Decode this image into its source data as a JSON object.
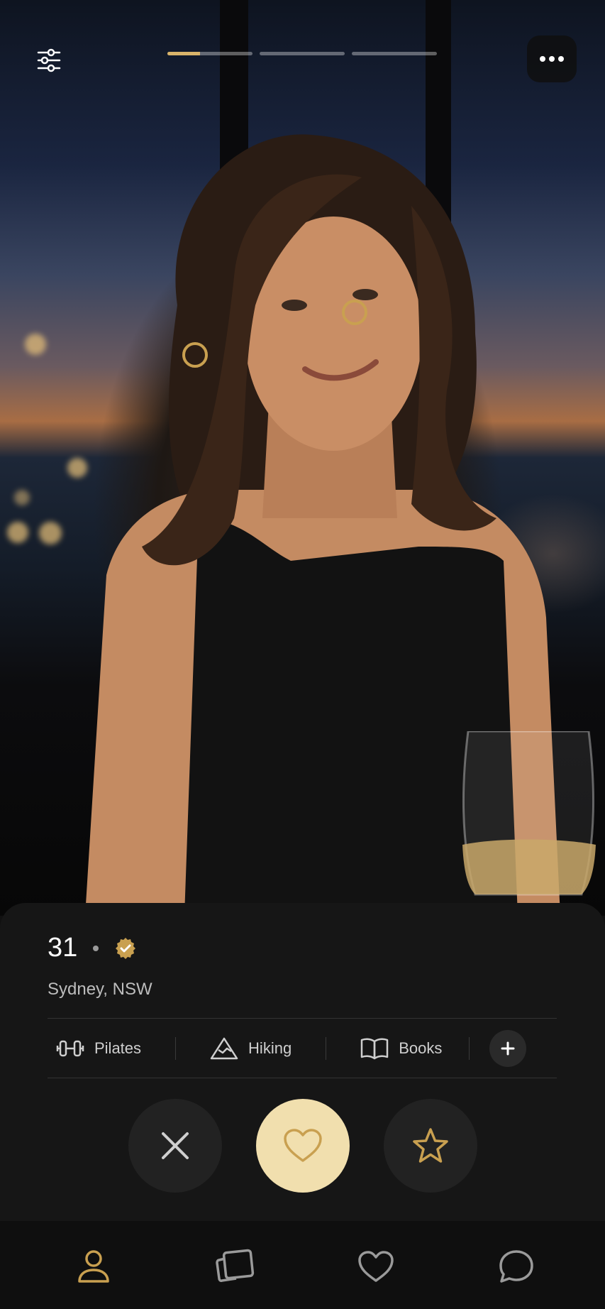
{
  "topbar": {
    "photo_progress": {
      "total": 3,
      "current": 1,
      "current_fraction": 0.38
    }
  },
  "profile": {
    "age": "31",
    "verified": true,
    "location": "Sydney, NSW"
  },
  "interests": [
    {
      "label": "Pilates",
      "icon": "dumbbell-icon"
    },
    {
      "label": "Hiking",
      "icon": "mountain-icon"
    },
    {
      "label": "Books",
      "icon": "book-icon"
    }
  ],
  "actions": [
    "dislike",
    "like",
    "super-like"
  ],
  "nav": [
    "profile",
    "cards",
    "likes",
    "messages"
  ],
  "colors": {
    "accent": "#d9b46a",
    "like_bg": "#f1dfae",
    "card_bg": "#161616",
    "nav_bg": "#0f0f0f"
  }
}
